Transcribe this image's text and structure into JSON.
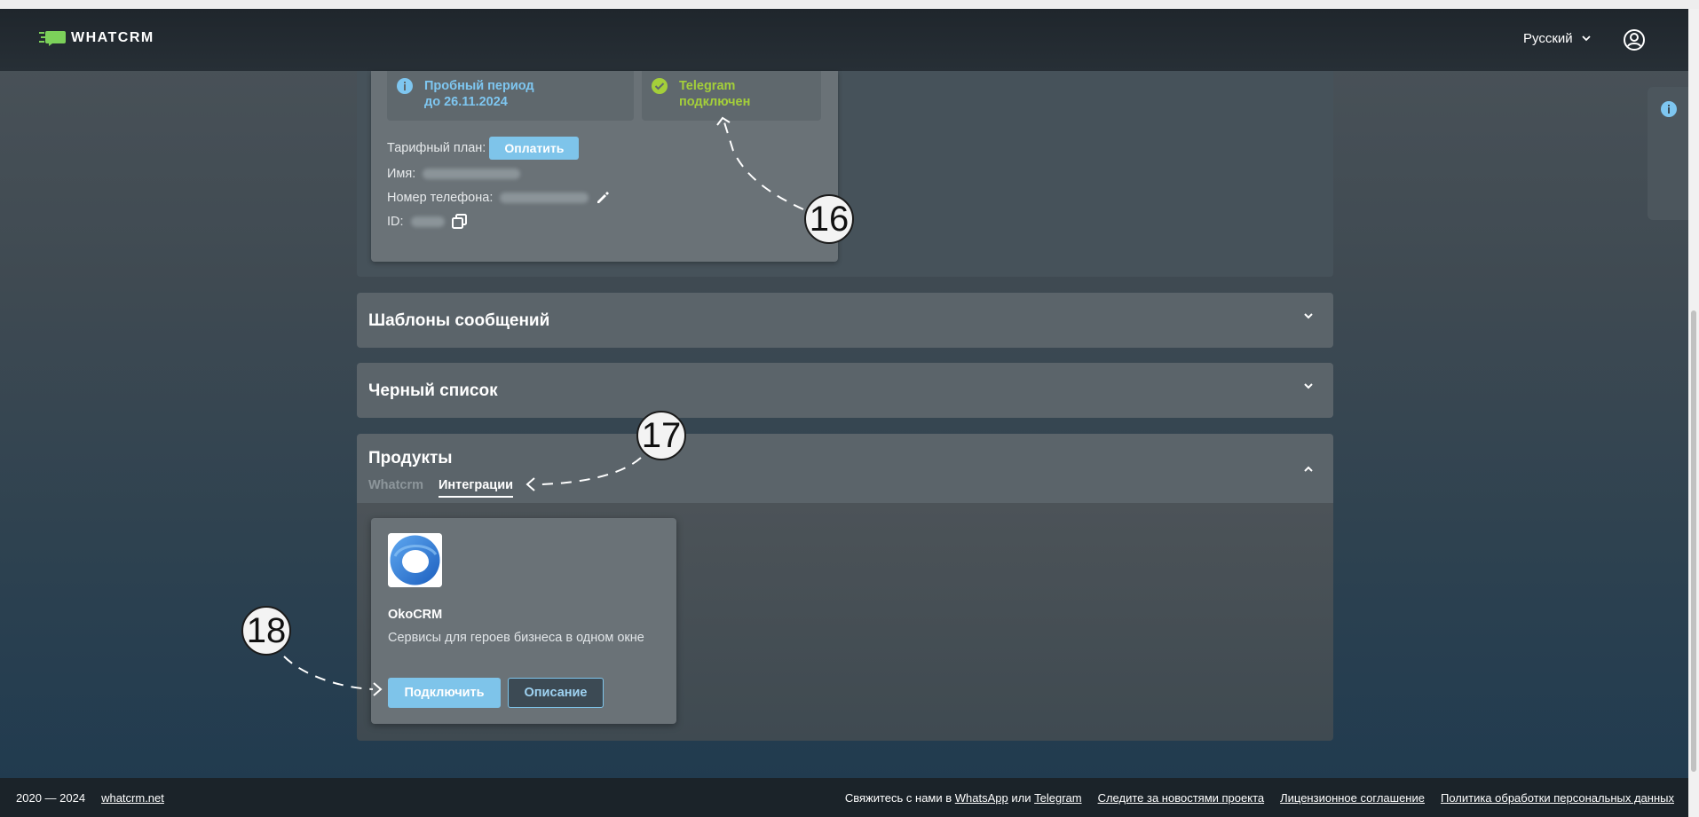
{
  "header": {
    "logo_text": "WHATCRM",
    "language": "Русский"
  },
  "account": {
    "trial_text": "Пробный период\nдо 26.11.2024",
    "telegram_status": "Telegram\nподключен",
    "plan_label": "Тарифный план:",
    "pay_button": "Оплатить",
    "name_label": "Имя:",
    "phone_label": "Номер телефона:",
    "id_label": "ID:"
  },
  "sections": {
    "templates": "Шаблоны сообщений",
    "blacklist": "Черный список",
    "products": "Продукты"
  },
  "products": {
    "tabs": [
      "Whatcrm",
      "Интеграции"
    ],
    "active_tab": "Интеграции",
    "integration": {
      "name": "OkoCRM",
      "description": "Сервисы для героев бизнеса в одном окне",
      "connect_button": "Подключить",
      "description_button": "Описание"
    }
  },
  "annotations": [
    "16",
    "17",
    "18"
  ],
  "footer": {
    "years": "2020 — 2024",
    "site_link": "whatcrm.net",
    "contact_prefix": "Свяжитесь с нами в",
    "contact_whatsapp": "WhatsApp",
    "contact_or": "или",
    "contact_telegram": "Telegram",
    "news_link": "Следите за новостями проекта",
    "license_link": "Лицензионное соглашение",
    "privacy_link": "Политика обработки персональных данных"
  },
  "colors": {
    "accent": "#7ec4ea",
    "success": "#a4cf3a",
    "info": "#7ec6f0"
  }
}
